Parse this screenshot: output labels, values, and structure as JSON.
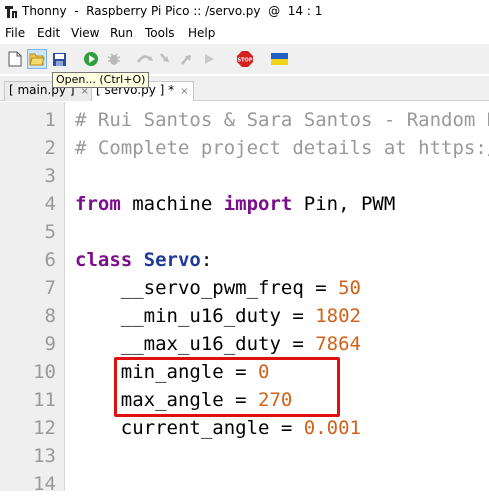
{
  "window": {
    "title": "Thonny  -  Raspberry Pi Pico :: /servo.py  @  14 : 1"
  },
  "menu": [
    "File",
    "Edit",
    "View",
    "Run",
    "Tools",
    "Help"
  ],
  "toolbar": {
    "tooltip": "Open... (Ctrl+O)",
    "icons": [
      "new-file-icon",
      "open-folder-icon",
      "save-icon",
      "run-icon",
      "debug-icon",
      "step-over-icon",
      "step-into-icon",
      "step-out-icon",
      "resume-icon",
      "stop-icon",
      "ukraine-flag-icon"
    ]
  },
  "tabs": [
    {
      "label": "[ main.py ]",
      "close": "×"
    },
    {
      "label": "[ servo.py ] *",
      "close": "×"
    }
  ],
  "editor": {
    "line_numbers": [
      "1",
      "2",
      "3",
      "4",
      "5",
      "6",
      "7",
      "8",
      "9",
      "10",
      "11",
      "12",
      "13",
      "14"
    ],
    "lines": {
      "l1": "# Rui Santos & Sara Santos - Random Nerd Tutorials",
      "l2": "# Complete project details at https://RandomNerdTutorials.com",
      "l4_kw1": "from",
      "l4_mid": " machine ",
      "l4_kw2": "import",
      "l4_end": " Pin, PWM",
      "l6_kw": "class",
      "l6_name": " Servo",
      "l6_end": ":",
      "l7_name": "    __servo_pwm_freq = ",
      "l7_val": "50",
      "l8_name": "    __min_u16_duty = ",
      "l8_val": "1802",
      "l9_name": "    __max_u16_duty = ",
      "l9_val": "7864",
      "l10_name": "    min_angle = ",
      "l10_val": "0",
      "l11_name": "    max_angle = ",
      "l11_val": "270",
      "l12_name": "    current_angle = ",
      "l12_val": "0.001"
    }
  }
}
